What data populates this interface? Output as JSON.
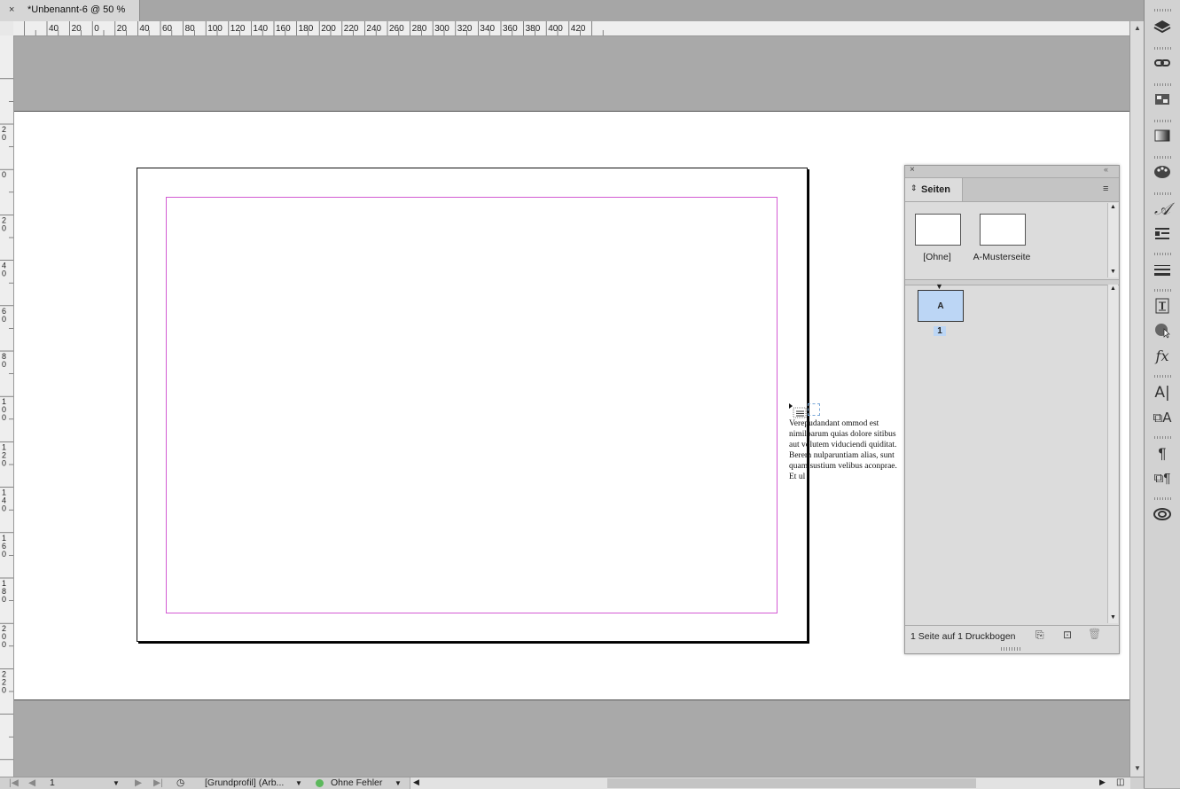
{
  "tab": {
    "close": "×",
    "title": "*Unbenannt-6 @ 50 %"
  },
  "ruler_h": {
    "labels": [
      "40",
      "20",
      "0",
      "20",
      "40",
      "60",
      "80",
      "100",
      "120",
      "140",
      "160",
      "180",
      "200",
      "220",
      "240",
      "260",
      "280",
      "300",
      "320",
      "340",
      "360",
      "380",
      "400",
      "420"
    ]
  },
  "ruler_v": {
    "labels": [
      "20",
      "0",
      "20",
      "40",
      "60",
      "80",
      "100",
      "120",
      "140",
      "160",
      "180",
      "200",
      "220"
    ]
  },
  "overset_text": "Verepudandant ommod est nimilparum quias dolore sitibus aut volutem viduciendi quiditat. Berem nulparuntiam alias, sunt quam sustium velibus aconprae. Et ul",
  "pages_panel": {
    "tab_label": "Seiten",
    "masters": [
      {
        "label": "[Ohne]"
      },
      {
        "label": "A-Musterseite"
      }
    ],
    "pages": [
      {
        "master_prefix": "A",
        "number": "1"
      }
    ],
    "footer_status": "1 Seite auf 1 Druckbogen"
  },
  "status_bar": {
    "page_number": "1",
    "preflight_profile": "[Grundprofil] (Arb...",
    "preflight_status": "Ohne Fehler",
    "status_color": "#5cb85c"
  },
  "colors": {
    "margin_guide": "#d35ad3",
    "selected_page": "#bcd6f5"
  },
  "dock_icons": [
    "layers-icon",
    "links-icon",
    "swatches-icon",
    "gradient-icon",
    "color-icon",
    "character-styles-icon",
    "paragraph-align-icon",
    "stroke-icon",
    "text-wrap-icon",
    "color-theme-icon",
    "effects-icon",
    "character-icon",
    "character-panel-icon",
    "paragraph-icon",
    "paragraph-styles-icon",
    "creative-cloud-icon"
  ]
}
